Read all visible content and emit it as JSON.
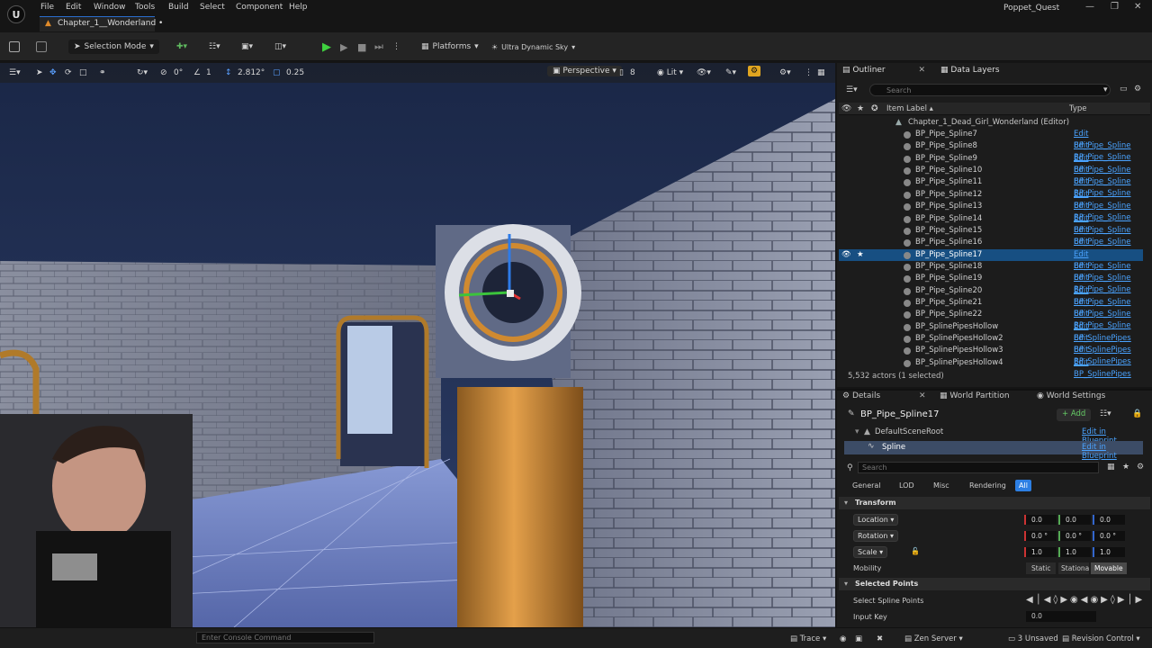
{
  "menubar": {
    "items": [
      "File",
      "Edit",
      "Window",
      "Tools",
      "Build",
      "Select",
      "Component",
      "Help"
    ],
    "project": "Poppet_Quest"
  },
  "map_tab": "Chapter_1__Wonderland •",
  "toolbar": {
    "mode": "Selection Mode",
    "platforms": "Platforms",
    "sky": "Ultra Dynamic Sky"
  },
  "viewport": {
    "snap_rotation": "0°",
    "snap_grid": "1",
    "camera_speed": "2.812°",
    "scale_snap": "0.25",
    "perspective": "Perspective",
    "lit": "Lit",
    "fov": "8"
  },
  "outliner": {
    "tab": "Outliner",
    "tab2": "Data Layers",
    "search_placeholder": "Search",
    "col_label": "Item Label ▴",
    "col_type": "Type",
    "root": "Chapter_1_Dead_Girl_Wonderland (Editor)",
    "rows": [
      {
        "name": "BP_Pipe_Spline7",
        "type": "Edit BP_Pipe_Spline"
      },
      {
        "name": "BP_Pipe_Spline8",
        "type": "Edit BP_Pipe_Spline"
      },
      {
        "name": "BP_Pipe_Spline9",
        "type": "Edit BP_Pipe_Spline"
      },
      {
        "name": "BP_Pipe_Spline10",
        "type": "Edit BP_Pipe_Spline"
      },
      {
        "name": "BP_Pipe_Spline11",
        "type": "Edit BP_Pipe_Spline"
      },
      {
        "name": "BP_Pipe_Spline12",
        "type": "Edit BP_Pipe_Spline"
      },
      {
        "name": "BP_Pipe_Spline13",
        "type": "Edit BP_Pipe_Spline"
      },
      {
        "name": "BP_Pipe_Spline14",
        "type": "Edit BP_Pipe_Spline"
      },
      {
        "name": "BP_Pipe_Spline15",
        "type": "Edit BP_Pipe_Spline"
      },
      {
        "name": "BP_Pipe_Spline16",
        "type": "Edit BP_Pipe_Spline"
      },
      {
        "name": "BP_Pipe_Spline17",
        "type": "Edit BP_Pipe_Spline",
        "selected": true
      },
      {
        "name": "BP_Pipe_Spline18",
        "type": "Edit BP_Pipe_Spline"
      },
      {
        "name": "BP_Pipe_Spline19",
        "type": "Edit BP_Pipe_Spline"
      },
      {
        "name": "BP_Pipe_Spline20",
        "type": "Edit BP_Pipe_Spline"
      },
      {
        "name": "BP_Pipe_Spline21",
        "type": "Edit BP_Pipe_Spline"
      },
      {
        "name": "BP_Pipe_Spline22",
        "type": "Edit BP_Pipe_Spline"
      },
      {
        "name": "BP_SplinePipesHollow",
        "type": "Edit BP_SplinePipes"
      },
      {
        "name": "BP_SplinePipesHollow2",
        "type": "Edit BP_SplinePipes"
      },
      {
        "name": "BP_SplinePipesHollow3",
        "type": "Edit BP_SplinePipes"
      },
      {
        "name": "BP_SplinePipesHollow4",
        "type": "Edit BP_SplinePipes"
      }
    ],
    "actor_count": "5,532 actors (1 selected)"
  },
  "details": {
    "tab": "Details",
    "tab2": "World Partition",
    "tab3": "World Settings",
    "actor_name": "BP_Pipe_Spline17",
    "add_label": "+ Add",
    "components": [
      {
        "name": "DefaultSceneRoot",
        "action": "Edit in Blueprint"
      },
      {
        "name": "Spline",
        "action": "Edit in Blueprint"
      }
    ],
    "search_placeholder": "Search",
    "categories": [
      "General",
      "LOD",
      "Misc",
      "Rendering",
      "All"
    ],
    "transform_header": "Transform",
    "location_label": "Location",
    "rotation_label": "Rotation",
    "scale_label": "Scale",
    "mobility_label": "Mobility",
    "location": [
      "0.0",
      "0.0",
      "0.0"
    ],
    "rotation": [
      "0.0 °",
      "0.0 °",
      "0.0 °"
    ],
    "scale": [
      "1.0",
      "1.0",
      "1.0"
    ],
    "mobility_options": [
      "Static",
      "Stationary",
      "Movable"
    ],
    "selected_points_header": "Selected Points",
    "select_spline_points": "Select Spline Points",
    "input_key_label": "Input Key",
    "input_key": "0.0"
  },
  "statusbar": {
    "console_placeholder": "Enter Console Command",
    "trace": "Trace",
    "zen": "Zen Server",
    "unsaved": "3 Unsaved",
    "revision": "Revision Control"
  }
}
